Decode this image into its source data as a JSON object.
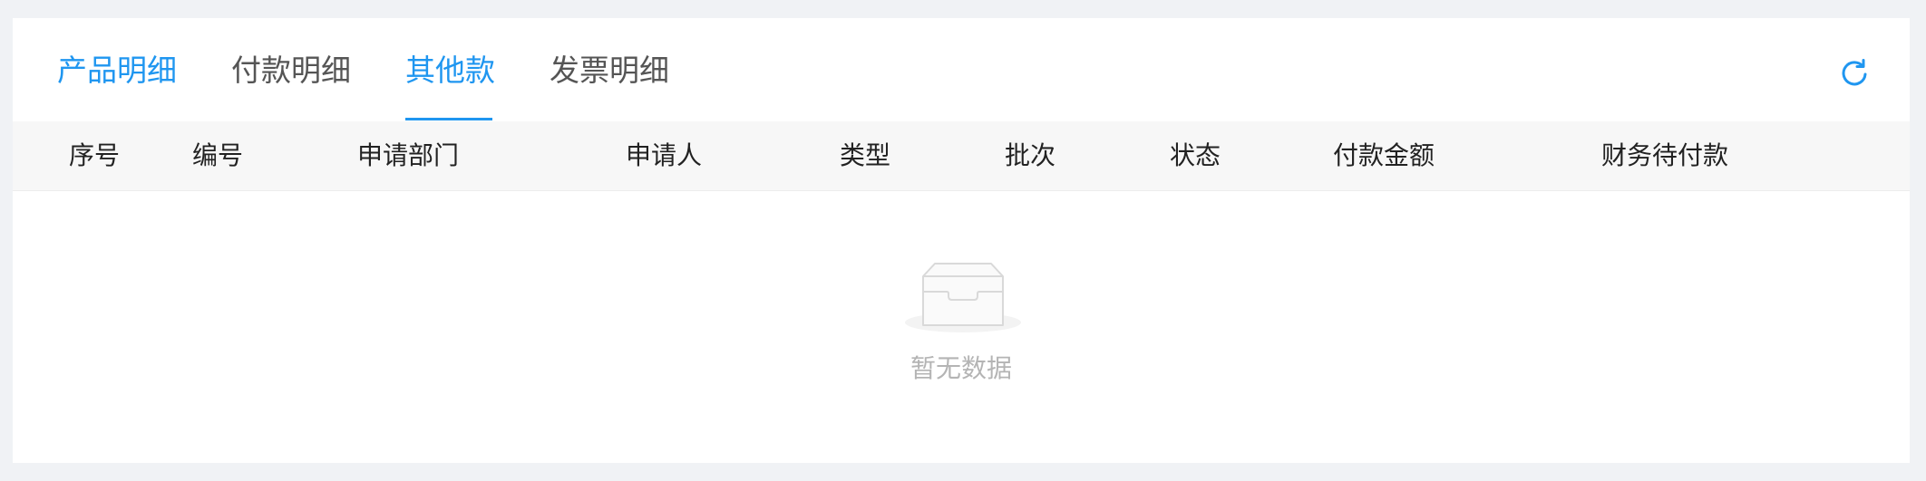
{
  "tabs": [
    {
      "label": "产品明细"
    },
    {
      "label": "付款明细"
    },
    {
      "label": "其他款"
    },
    {
      "label": "发票明细"
    }
  ],
  "active_tab": "其他款",
  "refresh_icon": "refresh-icon",
  "table": {
    "columns": [
      "序号",
      "编号",
      "申请部门",
      "申请人",
      "类型",
      "批次",
      "状态",
      "付款金额",
      "财务待付款"
    ],
    "rows": []
  },
  "empty": {
    "icon": "empty-inbox-icon",
    "text": "暂无数据"
  },
  "colors": {
    "accent": "#1f96f0",
    "page_bg": "#f0f2f5",
    "header_bg": "#f7f7f7",
    "muted_text": "#b4b4b4"
  }
}
